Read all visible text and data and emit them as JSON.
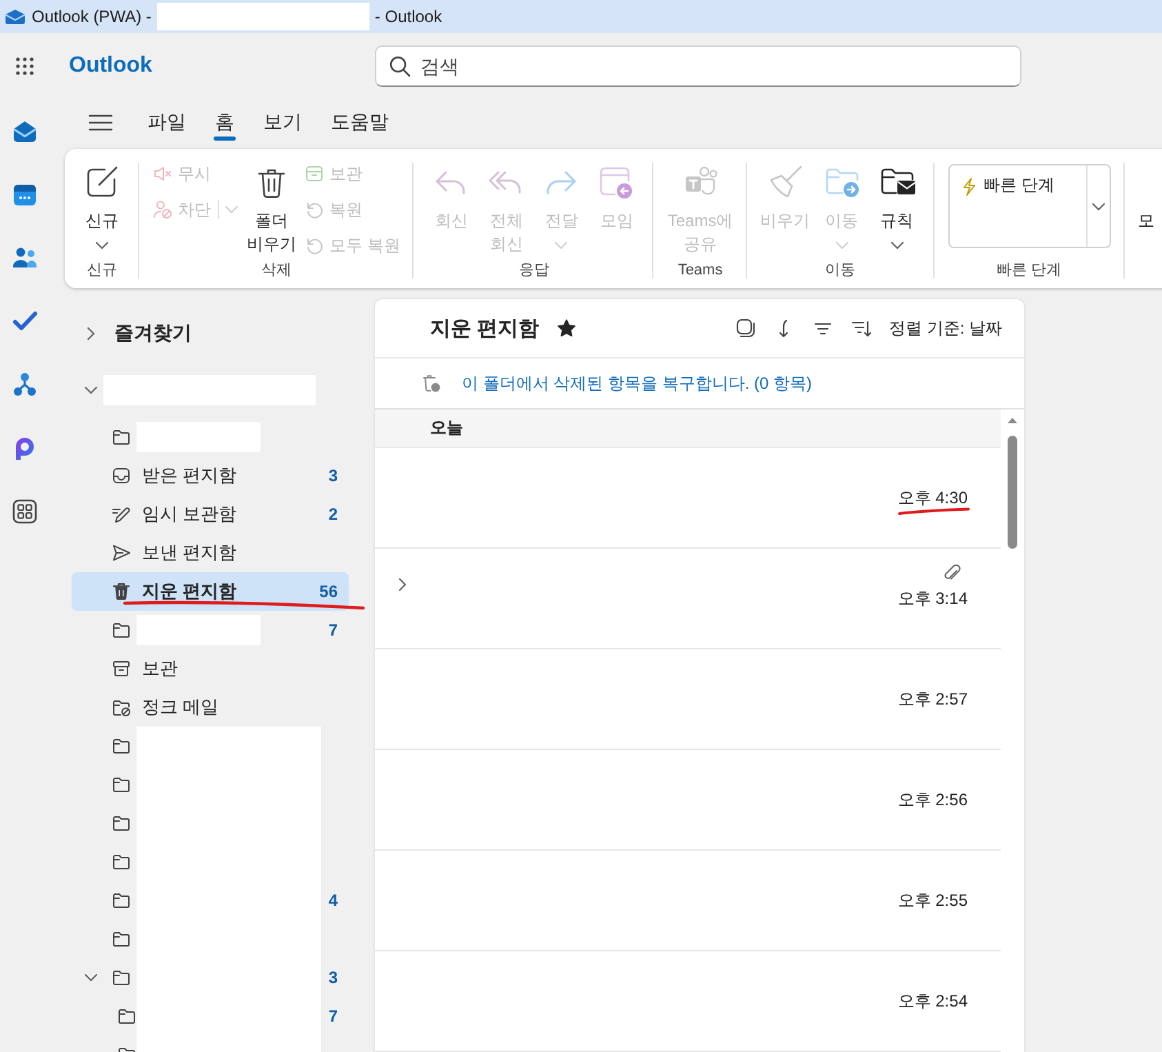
{
  "window": {
    "title_start": "Outlook (PWA) -",
    "title_redacted": true,
    "title_end": "- Outlook"
  },
  "header": {
    "app_name": "Outlook",
    "search": {
      "placeholder": "검색"
    }
  },
  "app_rail": [
    {
      "kind": "mail"
    },
    {
      "kind": "calendar"
    },
    {
      "kind": "people"
    },
    {
      "kind": "todo"
    },
    {
      "kind": "org"
    },
    {
      "kind": "ring"
    },
    {
      "kind": "apps"
    }
  ],
  "ribbon_tabs": [
    {
      "label": "파일",
      "selected": false
    },
    {
      "label": "홈",
      "selected": true
    },
    {
      "label": "보기",
      "selected": false
    },
    {
      "label": "도움말",
      "selected": false
    }
  ],
  "ribbon_groups": [
    {
      "label": "신규",
      "columns": [
        {
          "kind": "large",
          "items": [
            {
              "kind": "new",
              "label": "신규",
              "disabled": false,
              "dropdown": true
            }
          ]
        }
      ]
    },
    {
      "label": "삭제",
      "columns": [
        {
          "kind": "stack",
          "items": [
            {
              "kind": "ignore",
              "label": "무시",
              "disabled": true,
              "dropdown": false
            },
            {
              "kind": "block",
              "label": "차단",
              "disabled": true,
              "dropdown": true
            }
          ]
        },
        {
          "kind": "large",
          "items": [
            {
              "kind": "empty_folder",
              "label": "폴더\n비우기",
              "disabled": false,
              "dropdown": false
            }
          ]
        },
        {
          "kind": "stack",
          "items": [
            {
              "kind": "archive",
              "label": "보관",
              "disabled": true,
              "dropdown": false
            },
            {
              "kind": "restore",
              "label": "복원",
              "disabled": true,
              "dropdown": false
            },
            {
              "kind": "restore",
              "label": "모두 복원",
              "disabled": true,
              "dropdown": false
            }
          ]
        }
      ]
    },
    {
      "label": "응답",
      "columns": [
        {
          "kind": "large",
          "items": [
            {
              "kind": "reply",
              "label": "회신",
              "disabled": true,
              "dropdown": false
            },
            {
              "kind": "reply_all",
              "label": "전체\n회신",
              "disabled": true,
              "dropdown": false
            },
            {
              "kind": "forward",
              "label": "전달",
              "disabled": true,
              "dropdown": true
            },
            {
              "kind": "meeting",
              "label": "모임",
              "disabled": true,
              "dropdown": false
            }
          ]
        }
      ]
    },
    {
      "label": "Teams",
      "columns": [
        {
          "kind": "large",
          "items": [
            {
              "kind": "share_teams",
              "label": "Teams에\n공유",
              "disabled": true,
              "dropdown": false
            }
          ]
        }
      ]
    },
    {
      "label": "이동",
      "columns": [
        {
          "kind": "large",
          "items": [
            {
              "kind": "sweep",
              "label": "비우기",
              "disabled": true,
              "dropdown": false
            },
            {
              "kind": "move",
              "label": "이동",
              "disabled": true,
              "dropdown": true
            },
            {
              "kind": "rules",
              "label": "규칙",
              "disabled": false,
              "dropdown": true
            }
          ]
        }
      ]
    },
    {
      "label": "빠른 단계",
      "columns": [
        {
          "kind": "gallery",
          "items": [
            {
              "kind": "quick_step",
              "label": "빠른 단계"
            }
          ]
        }
      ]
    },
    {
      "columns": [
        {
          "kind": "text",
          "items": [
            {
              "label": "모"
            }
          ]
        }
      ]
    }
  ],
  "folder_pane": {
    "favorites": {
      "label": "즐겨찾기",
      "expanded": false
    },
    "accounts": [
      {
        "redacted": true,
        "expanded": true,
        "children": [
          {
            "kind": "folder",
            "redacted": true,
            "selected": false,
            "underlined": false
          },
          {
            "kind": "inbox",
            "label": "받은 편지함",
            "count": "3",
            "redacted": false,
            "selected": false,
            "underlined": false
          },
          {
            "kind": "drafts",
            "label": "임시 보관함",
            "count": "2",
            "redacted": false,
            "selected": false,
            "underlined": false
          },
          {
            "kind": "sent",
            "label": "보낸 편지함",
            "redacted": false,
            "selected": false,
            "underlined": false
          },
          {
            "kind": "deleted",
            "label": "지운 편지함",
            "count": "56",
            "redacted": false,
            "selected": true,
            "underlined": true
          },
          {
            "kind": "folder",
            "count": "7",
            "redacted": true,
            "selected": false,
            "underlined": false
          },
          {
            "kind": "archive",
            "label": "보관",
            "redacted": false,
            "selected": false,
            "underlined": false
          },
          {
            "kind": "junk",
            "label": "정크 메일",
            "redacted": false,
            "selected": false,
            "underlined": false
          },
          {
            "kind": "folder",
            "redacted": true,
            "selected": false,
            "underlined": false
          },
          {
            "kind": "folder",
            "redacted": true,
            "selected": false,
            "underlined": false
          },
          {
            "kind": "folder",
            "redacted": true,
            "selected": false,
            "underlined": false
          },
          {
            "kind": "folder",
            "redacted": true,
            "selected": false,
            "underlined": false
          },
          {
            "kind": "folder",
            "count": "4",
            "redacted": true,
            "selected": false,
            "underlined": false
          },
          {
            "kind": "folder",
            "redacted": true,
            "selected": false,
            "underlined": false
          },
          {
            "kind": "folder",
            "count": "3",
            "redacted": true,
            "selected": false,
            "underlined": false,
            "expanded": true,
            "children": [
              {
                "kind": "folder",
                "count": "7",
                "redacted": true,
                "selected": false,
                "underlined": false
              },
              {
                "kind": "folder",
                "redacted": true,
                "selected": false,
                "underlined": false
              }
            ]
          }
        ]
      }
    ]
  },
  "message_list": {
    "title": "지운 편지함",
    "favorite": true,
    "sort_label": "정렬 기준: 날짜",
    "recover_link": "이 폴더에서 삭제된 항목을 복구합니다. (0 항목)",
    "groups": [
      {
        "label": "오늘",
        "messages": [
          {
            "time": "오후 4:30",
            "thread": false,
            "attachment": false,
            "underlined": true
          },
          {
            "time": "오후 3:14",
            "thread": true,
            "attachment": true,
            "underlined": false
          },
          {
            "time": "오후 2:57",
            "thread": false,
            "attachment": false,
            "underlined": false
          },
          {
            "time": "오후 2:56",
            "thread": false,
            "attachment": false,
            "underlined": false
          },
          {
            "time": "오후 2:55",
            "thread": false,
            "attachment": false,
            "underlined": false
          },
          {
            "time": "오후 2:54",
            "thread": false,
            "attachment": false,
            "underlined": false
          }
        ]
      }
    ]
  }
}
